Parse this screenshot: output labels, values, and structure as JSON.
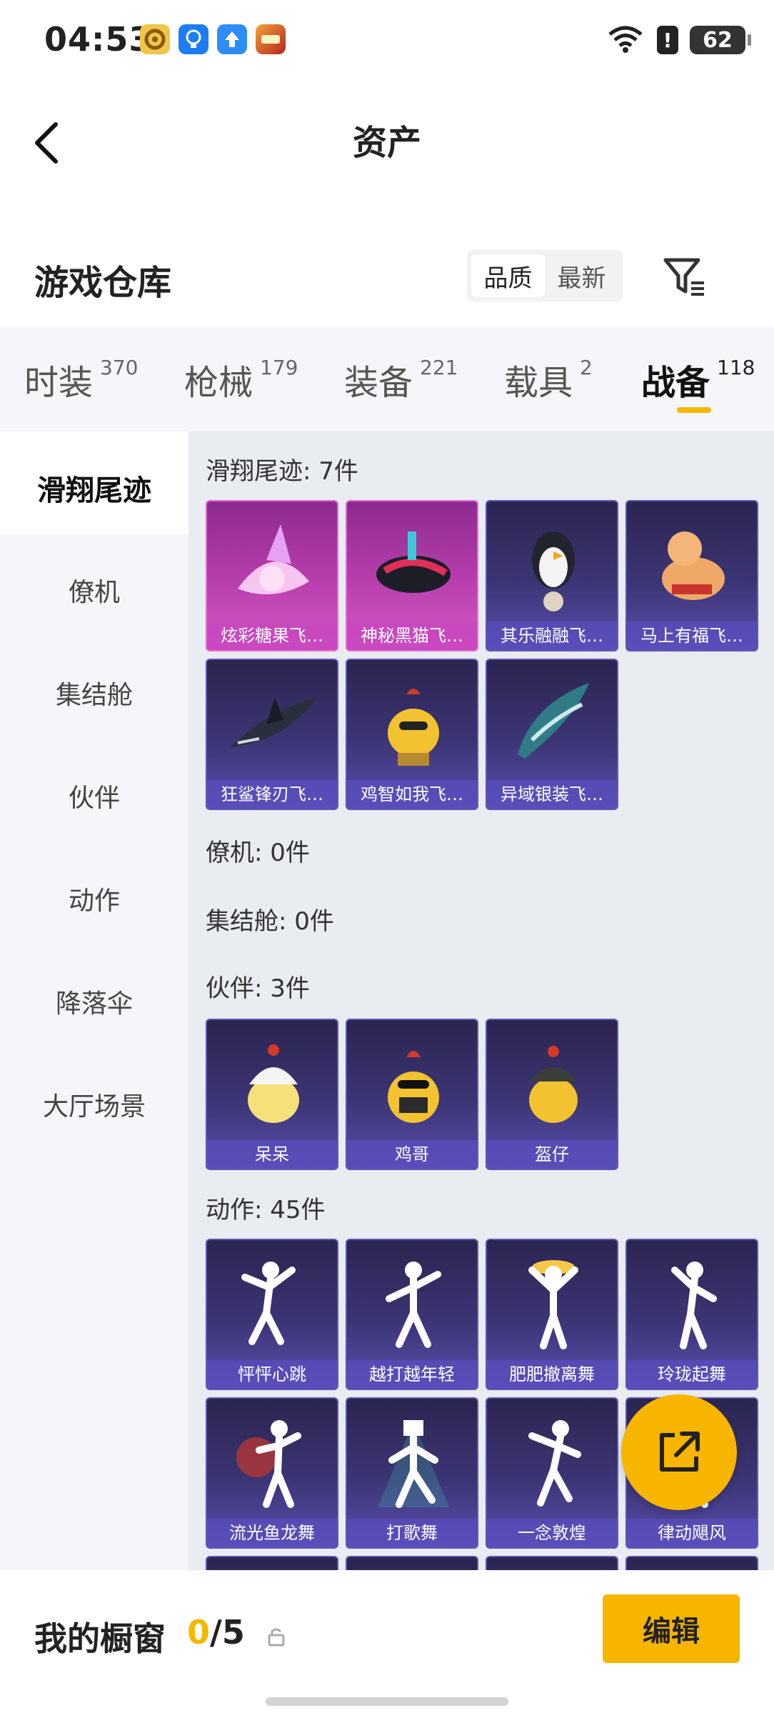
{
  "status_bar": {
    "time": "04:53",
    "battery": "62",
    "alert": "!",
    "notification_icons": [
      "app-1-icon",
      "bulb-app-icon",
      "upload-app-icon",
      "game-app-icon"
    ]
  },
  "header": {
    "title": "资产"
  },
  "warehouse": {
    "title": "游戏仓库",
    "sort": {
      "quality": "品质",
      "latest": "最新",
      "selected": "品质"
    }
  },
  "tabs": [
    {
      "label": "时装",
      "count": "370"
    },
    {
      "label": "枪械",
      "count": "179"
    },
    {
      "label": "装备",
      "count": "221"
    },
    {
      "label": "载具",
      "count": "2"
    },
    {
      "label": "战备",
      "count": "118",
      "active": true
    }
  ],
  "sidebar": {
    "items": [
      "滑翔尾迹",
      "僚机",
      "集结舱",
      "伙伴",
      "动作",
      "降落伞",
      "大厅场景"
    ],
    "active": "滑翔尾迹"
  },
  "sections": {
    "glide": {
      "title": "滑翔尾迹: 7件",
      "items": [
        "炫彩糖果飞…",
        "神秘黑猫飞…",
        "其乐融融飞…",
        "马上有福飞…",
        "狂鲨锋刃飞…",
        "鸡智如我飞…",
        "异域银装飞…"
      ]
    },
    "wingman": {
      "title": "僚机: 0件"
    },
    "capsule": {
      "title": "集结舱: 0件"
    },
    "partner": {
      "title": "伙伴: 3件",
      "items": [
        "呆呆",
        "鸡哥",
        "盔仔"
      ]
    },
    "emote": {
      "title": "动作: 45件",
      "items": [
        "怦怦心跳",
        "越打越年轻",
        "肥肥撤离舞",
        "玲珑起舞",
        "流光鱼龙舞",
        "打歌舞",
        "一念敦煌",
        "律动飓风"
      ]
    }
  },
  "showcase": {
    "label": "我的橱窗",
    "count": "0",
    "total": "/5",
    "edit": "编辑"
  },
  "colors": {
    "accent": "#f7b500",
    "card_purple": "#3c3575",
    "card_pink": "#b93fae"
  }
}
